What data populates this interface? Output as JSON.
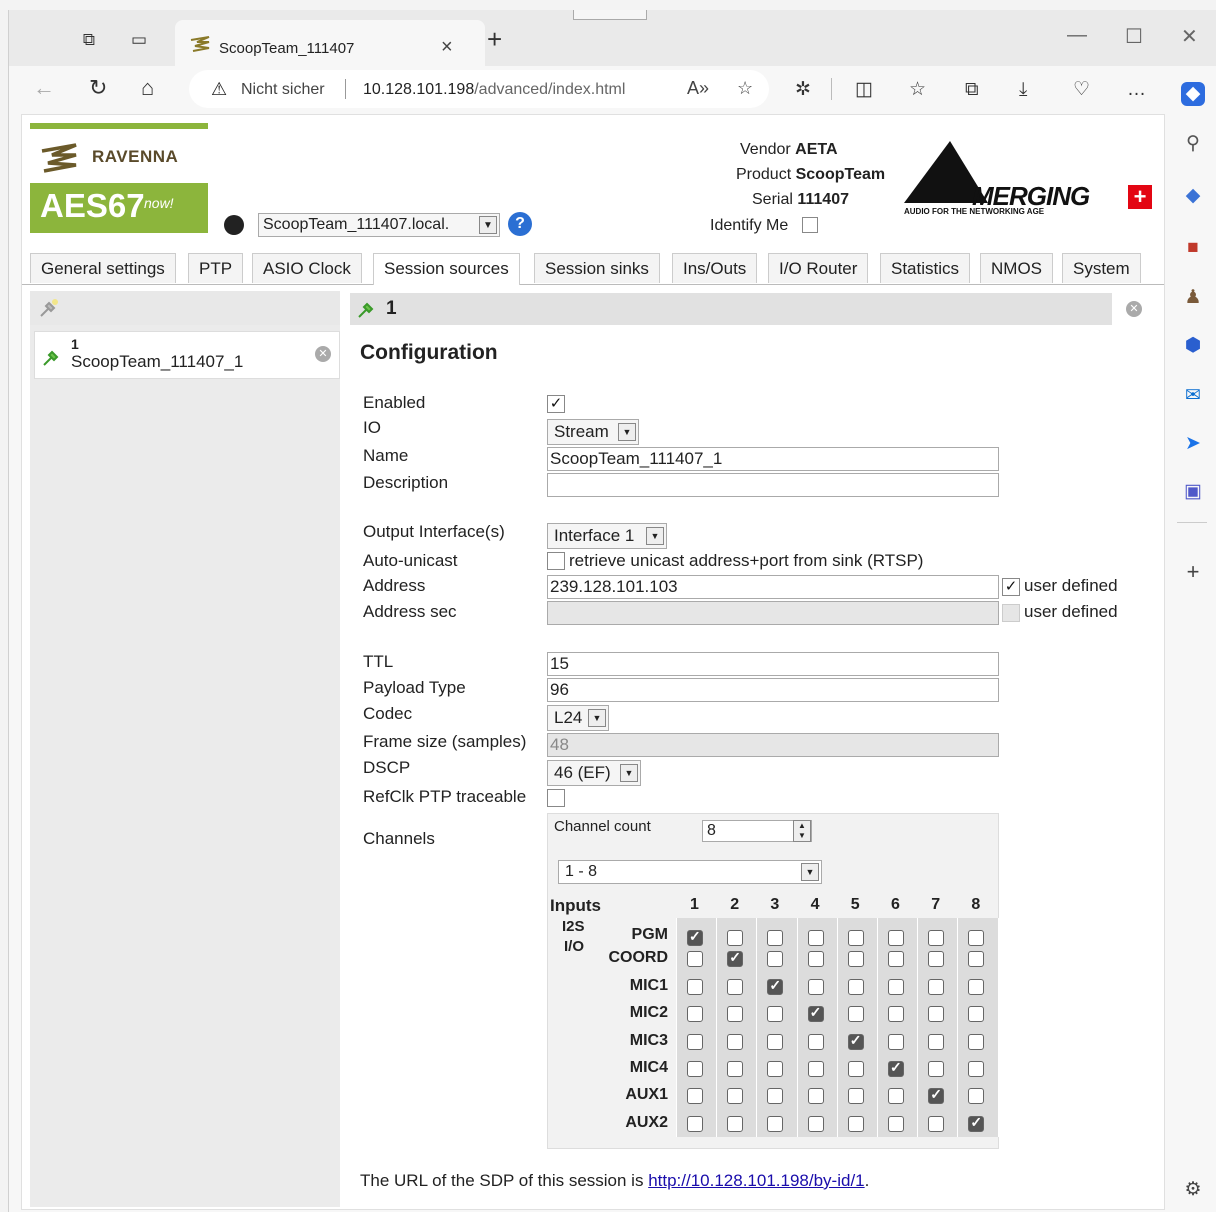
{
  "browser": {
    "tab_title": "ScoopTeam_111407",
    "not_secure": "Nicht sicher",
    "url_host": "10.128.101.198",
    "url_path": "/advanced/index.html"
  },
  "header": {
    "ravenna_label": "RAVENNA",
    "aes_label": "AES67",
    "aes_now": "now!",
    "host": "ScoopTeam_111407.local.",
    "vendor_label": "Vendor",
    "vendor": "AETA",
    "product_label": "Product",
    "product": "ScoopTeam",
    "serial_label": "Serial",
    "serial": "111407",
    "identify_label": "Identify Me",
    "merging_text": "MERGING",
    "merging_tag": "AUDIO FOR THE NETWORKING AGE"
  },
  "tabs": [
    "General settings",
    "PTP",
    "ASIO Clock",
    "Session sources",
    "Session sinks",
    "Ins/Outs",
    "I/O Router",
    "Statistics",
    "NMOS",
    "System"
  ],
  "left": {
    "item_num": "1",
    "item_name": "ScoopTeam_111407_1"
  },
  "right": {
    "header_num": "1",
    "title": "Configuration",
    "labels": {
      "enabled": "Enabled",
      "io": "IO",
      "name": "Name",
      "description": "Description",
      "output_if": "Output Interface(s)",
      "auto_unicast": "Auto-unicast",
      "address": "Address",
      "address_sec": "Address sec",
      "ttl": "TTL",
      "payload": "Payload Type",
      "codec": "Codec",
      "frame": "Frame size (samples)",
      "dscp": "DSCP",
      "refclk": "RefClk PTP traceable",
      "channels": "Channels"
    },
    "io_value": "Stream",
    "name_value": "ScoopTeam_111407_1",
    "description_value": "",
    "output_if_value": "Interface 1",
    "auto_unicast_text": "retrieve unicast address+port from sink (RTSP)",
    "address_value": "239.128.101.103",
    "user_defined": "user defined",
    "ttl_value": "15",
    "payload_value": "96",
    "codec_value": "L24",
    "frame_value": "48",
    "dscp_value": "46 (EF)",
    "channel_count_label": "Channel count",
    "channel_count_value": "8",
    "range_value": "1 - 8",
    "inputs_label": "Inputs",
    "group_label_1": "I2S",
    "group_label_2": "I/O",
    "columns": [
      "1",
      "2",
      "3",
      "4",
      "5",
      "6",
      "7",
      "8"
    ],
    "rows": [
      "PGM",
      "COORD",
      "MIC1",
      "MIC2",
      "MIC3",
      "MIC4",
      "AUX1",
      "AUX2"
    ]
  },
  "footer": {
    "prefix": "The URL of the SDP of this session is ",
    "link": "http://10.128.101.198/by-id/1",
    "suffix": "."
  }
}
